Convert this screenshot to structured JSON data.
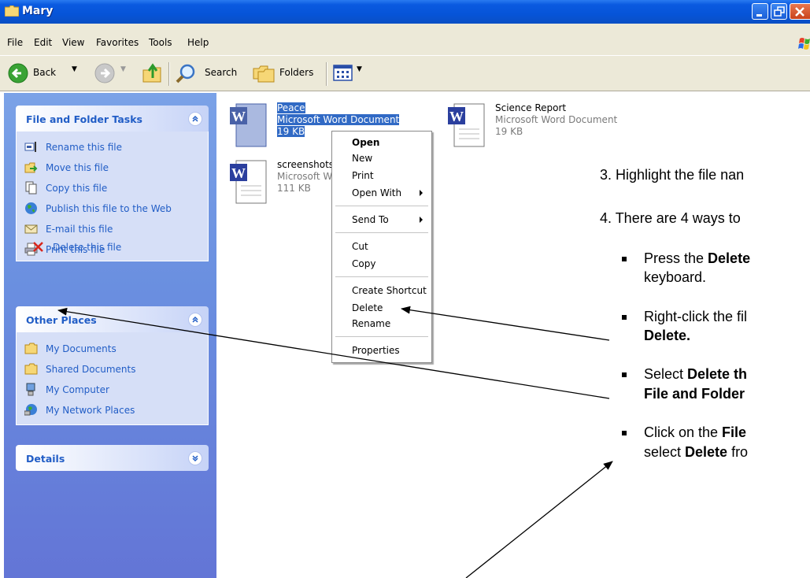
{
  "window": {
    "title": "Mary",
    "colors": {
      "titlebar": "#0654d8",
      "taskpane": "#6a8fe0",
      "selection": "#316ac5",
      "link": "#215dc6"
    }
  },
  "menu": [
    "File",
    "Edit",
    "View",
    "Favorites",
    "Tools",
    "Help"
  ],
  "toolbar": {
    "back": "Back",
    "search": "Search",
    "folders": "Folders"
  },
  "tasks": {
    "file_folder": {
      "title": "File and Folder Tasks",
      "items": [
        "Rename this file",
        "Move this file",
        "Copy this file",
        "Publish this file to the Web",
        "E-mail this file",
        "Print this file",
        "Delete this file"
      ]
    },
    "other_places": {
      "title": "Other Places",
      "items": [
        "My Documents",
        "Shared Documents",
        "My Computer",
        "My Network Places"
      ]
    },
    "details": {
      "title": "Details"
    }
  },
  "files": [
    {
      "name": "Peace",
      "type": "Microsoft Word Document",
      "size": "19 KB"
    },
    {
      "name": "Science Report",
      "type": "Microsoft Word Document",
      "size": "19 KB"
    },
    {
      "name": "screenshots",
      "type": "Microsoft W",
      "size": "111 KB"
    }
  ],
  "context_menu": {
    "open": "Open",
    "new": "New",
    "print": "Print",
    "open_with": "Open With",
    "send_to": "Send To",
    "cut": "Cut",
    "copy": "Copy",
    "create_shortcut": "Create Shortcut",
    "delete": "Delete",
    "rename": "Rename",
    "properties": "Properties"
  },
  "document": {
    "step3": "3.  Highlight the file nan",
    "step4": "4.  There are 4 ways to",
    "b1a_pre": "Press the ",
    "b1a_bold": "Delete",
    "b1b": "keyboard.",
    "b2a": "Right-click the fil",
    "b2b_bold": "Delete.",
    "b3a_pre": "Select ",
    "b3a_bold": "Delete th",
    "b3b_bold": "File and Folder",
    "b4a_pre": "Click on the ",
    "b4a_bold": "File",
    "b4b_pre": "select ",
    "b4b_bold": "Delete",
    "b4b_post": " fro"
  }
}
